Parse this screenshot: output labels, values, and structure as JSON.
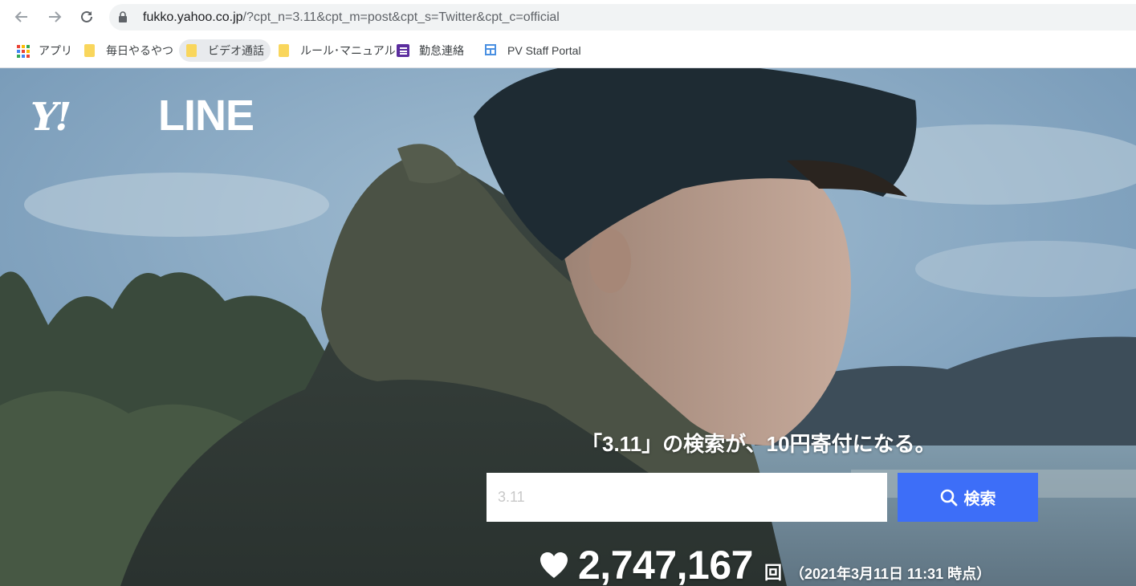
{
  "browser": {
    "url_host": "fukko.yahoo.co.jp",
    "url_rest": "/?cpt_n=3.11&cpt_m=post&cpt_s=Twitter&cpt_c=official",
    "nav_icons": [
      "back-arrow-icon",
      "forward-arrow-icon",
      "reload-icon"
    ],
    "bookmarks": [
      {
        "label": "アプリ",
        "icon": "apps-grid-icon"
      },
      {
        "label": "毎日やるやつ",
        "icon": "folder-icon"
      },
      {
        "label": "ビデオ通話",
        "icon": "folder-icon"
      },
      {
        "label": "ルール･マニュアル",
        "icon": "folder-icon"
      },
      {
        "label": "勤怠連絡",
        "icon": "list-icon"
      },
      {
        "label": "PV Staff Portal",
        "icon": "portal-icon"
      }
    ]
  },
  "hero": {
    "logo_yahoo": "Y!",
    "logo_line": "LINE",
    "tagline": "「3.11」の検索が、10円寄付になる。",
    "search": {
      "value": "",
      "placeholder": "3.11",
      "button_label": "検索"
    },
    "counter": {
      "count": "2,747,167",
      "unit": "回",
      "as_of": "（2021年3月11日 11:31 時点）"
    }
  },
  "colors": {
    "search_button": "#3d6ef8",
    "folder": "#f9d65c"
  }
}
